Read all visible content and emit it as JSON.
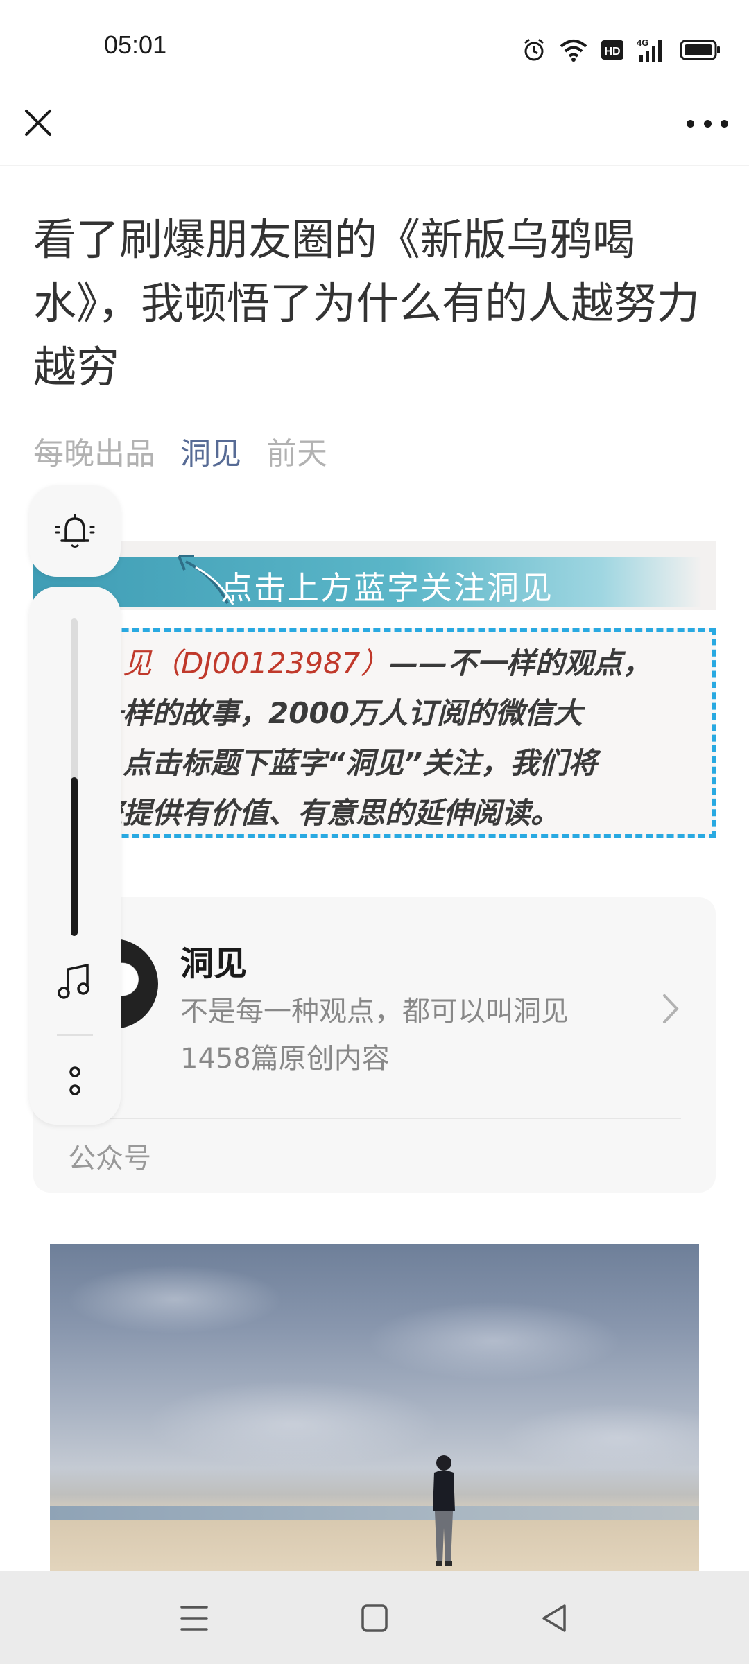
{
  "status_bar": {
    "time": "05:01",
    "icons": [
      "alarm-icon",
      "wifi-icon",
      "hd-icon",
      "4g-signal-icon",
      "battery-icon"
    ],
    "hd_label": "HD",
    "network_label": "4G"
  },
  "top_bar": {
    "close_icon": "close-icon",
    "more_icon": "more-icon"
  },
  "article": {
    "title": "看了刷爆朋友圈的《新版乌鸦喝水》，我顿悟了为什么有的人越努力越穷",
    "meta": {
      "author": "每晚出品",
      "account": "洞见",
      "date": "前天"
    },
    "banner_text": "点击上方蓝字关注洞见",
    "intro": {
      "line1_red": "见（DJ00123987）",
      "line1_rest": "——不一样的观点，",
      "line2": "一样的故事，2000万人订阅的微信大",
      "line3": "，点击标题下蓝字“洞见”关注，我们将",
      "line4": "您提供有价值、有意思的延伸阅读。"
    }
  },
  "floating_panel": {
    "bell_icon": "bell-icon",
    "volume_level": 0.5,
    "music_icon": "music-note-icon",
    "options_icon": "vertical-dots-icon"
  },
  "account_card": {
    "name": "洞见",
    "description": "不是每一种观点，都可以叫洞见",
    "count": "1458篇原创内容",
    "label": "公众号"
  },
  "colors": {
    "link": "#576b95",
    "meta_gray": "#b2b2b2",
    "banner_blue": "#3f9db5",
    "dashed_border": "#29a9e1",
    "intro_red": "#c0392b"
  },
  "nav_bar": {
    "icons": [
      "menu-icon",
      "home-square-icon",
      "back-triangle-icon"
    ]
  }
}
